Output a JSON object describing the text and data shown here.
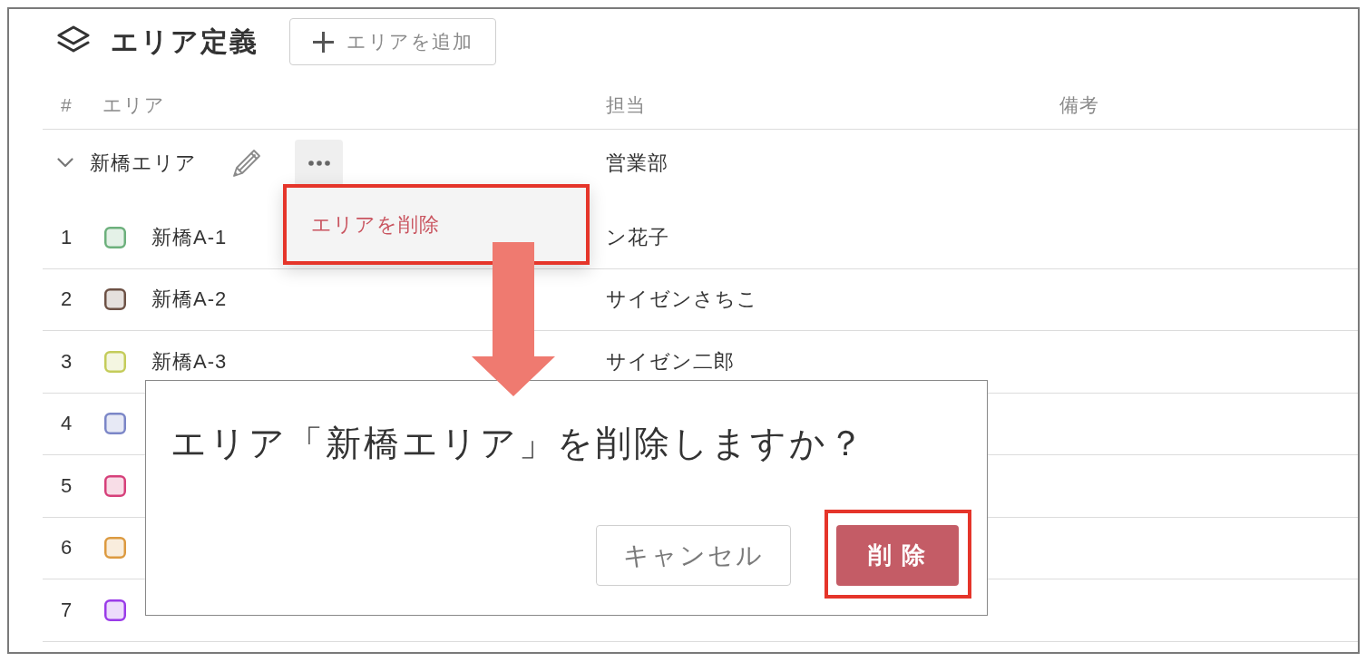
{
  "header": {
    "title": "エリア定義",
    "add_button": "エリアを追加"
  },
  "table": {
    "columns": [
      "#",
      "エリア",
      "担当",
      "備考"
    ],
    "groups": [
      {
        "name": "新橋エリア",
        "expanded": true,
        "owner": "営業部",
        "rows": [
          {
            "number": "1",
            "name": "新橋A-1",
            "owner": "ン花子",
            "color": "#6cb07c"
          },
          {
            "number": "2",
            "name": "新橋A-2",
            "owner": "サイゼンさちこ",
            "color": "#6d5145"
          },
          {
            "number": "3",
            "name": "新橋A-3",
            "owner": "サイゼン二郎",
            "color": "#c4cc5a"
          },
          {
            "number": "4",
            "color": "#7b86c7"
          },
          {
            "number": "5",
            "color": "#d6407a"
          },
          {
            "number": "6",
            "color": "#dc9a40"
          },
          {
            "number": "7",
            "color": "#9a3be8"
          }
        ]
      }
    ]
  },
  "menu": {
    "items": [
      {
        "label": "エリアを削除",
        "highlighted": true
      }
    ]
  },
  "dialog": {
    "message": "エリア「新橋エリア」を削除しますか？",
    "buttons": [
      {
        "kind": "secondary",
        "label": "キャンセル",
        "highlighted": false
      },
      {
        "kind": "danger",
        "label": "削 除",
        "highlighted": true
      }
    ]
  }
}
